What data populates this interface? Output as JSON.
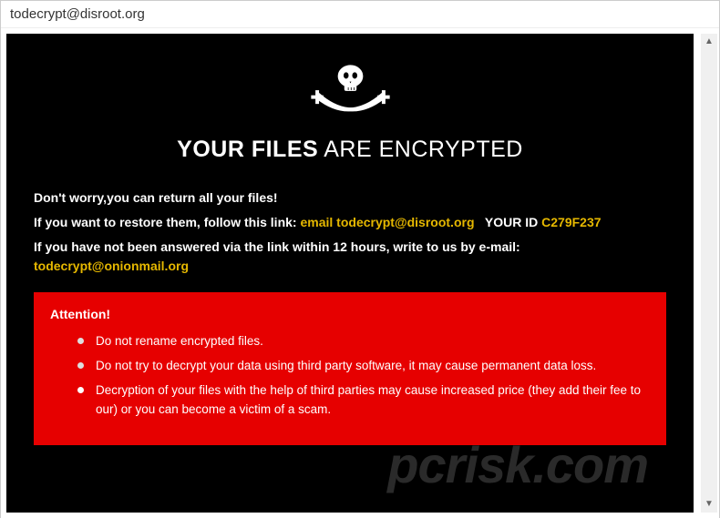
{
  "window": {
    "title": "todecrypt@disroot.org"
  },
  "headline": {
    "bold": "YOUR FILES",
    "regular": " ARE ENCRYPTED"
  },
  "lines": {
    "l1": "Don't worry,you can return all your files!",
    "l2a": "If you want to restore them, follow this link: ",
    "l2_email_label": "email ",
    "l2_email": "todecrypt@disroot.org",
    "l2_gap": "   ",
    "l2_yourid_label": "YOUR ID ",
    "l2_yourid": "C279F237",
    "l3a": "If you have not been answered via the link within 12 hours, write to us by e-mail: ",
    "l3_email": "todecrypt@onionmail.org"
  },
  "attention": {
    "heading": "Attention!",
    "bullets": [
      "Do not rename encrypted files.",
      "Do not try to decrypt your data using third party software, it may cause permanent data loss.",
      "Decryption of your files with the help of third parties may cause increased price (they add their fee to our) or you can become a victim of a scam."
    ]
  },
  "watermark": "pcrisk.com"
}
